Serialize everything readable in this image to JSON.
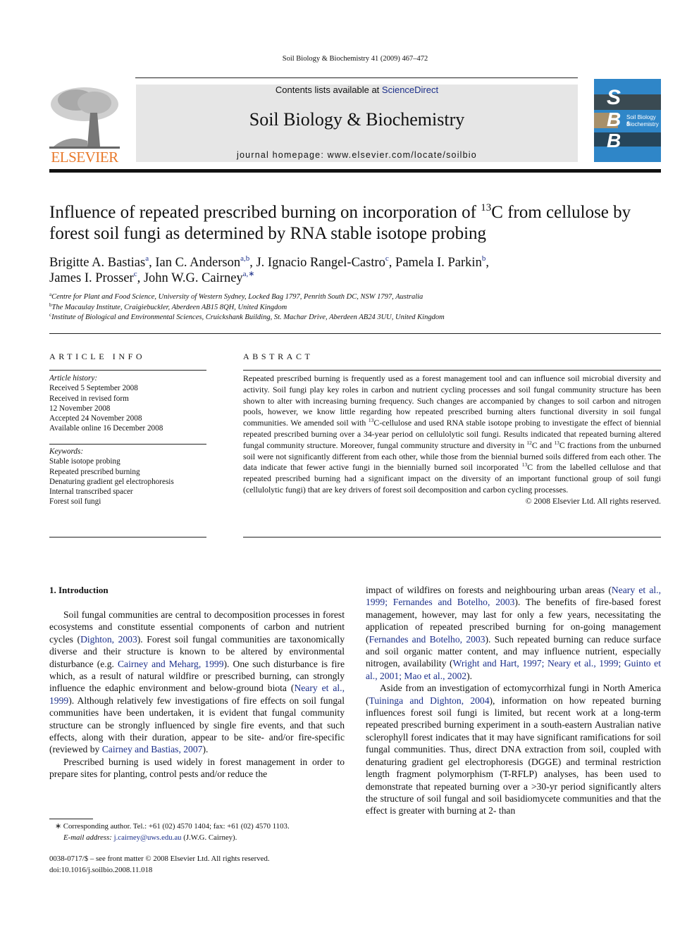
{
  "running_head": "Soil Biology & Biochemistry 41 (2009) 467–472",
  "publisher": {
    "name": "ELSEVIER",
    "brand_color": "#e8792b"
  },
  "masthead": {
    "contents_prefix": "Contents lists available at ",
    "contents_link": "ScienceDirect",
    "journal_title": "Soil Biology & Biochemistry",
    "homepage": "journal homepage: www.elsevier.com/locate/soilbio",
    "background_color": "#e6e6e6"
  },
  "cover": {
    "letters": [
      "S",
      "B",
      "B"
    ],
    "title_line1": "Soil Biology &",
    "title_line2": "Biochemistry",
    "color": "#2f86c8"
  },
  "article": {
    "title_part1": "Influence of repeated prescribed burning on incorporation of ",
    "title_sup": "13",
    "title_part2": "C from cellulose by forest soil fungi as determined by RNA stable isotope probing",
    "authors": [
      {
        "name": "Brigitte A. Bastias",
        "aff": "a",
        "sep": ", "
      },
      {
        "name": "Ian C. Anderson",
        "aff": "a,b",
        "sep": ", "
      },
      {
        "name": "J. Ignacio Rangel-Castro",
        "aff": "c",
        "sep": ", "
      },
      {
        "name": "Pamela I. Parkin",
        "aff": "b",
        "sep": ","
      },
      {
        "name": "James I. Prosser",
        "aff": "c",
        "sep": ", "
      },
      {
        "name": "John W.G. Cairney",
        "aff": "a,∗",
        "sep": ""
      }
    ],
    "affiliations": [
      {
        "key": "a",
        "text": "Centre for Plant and Food Science, University of Western Sydney, Locked Bag 1797, Penrith South DC, NSW 1797, Australia"
      },
      {
        "key": "b",
        "text": "The Macaulay Institute, Craigiebuckler, Aberdeen AB15 8QH, United Kingdom"
      },
      {
        "key": "c",
        "text": "Institute of Biological and Environmental Sciences, Cruickshank Building, St. Machar Drive, Aberdeen AB24 3UU, United Kingdom"
      }
    ]
  },
  "article_info": {
    "heading": "ARTICLE INFO",
    "history_label": "Article history:",
    "history": [
      "Received 5 September 2008",
      "Received in revised form",
      "12 November 2008",
      "Accepted 24 November 2008",
      "Available online 16 December 2008"
    ],
    "keywords_label": "Keywords:",
    "keywords": [
      "Stable isotope probing",
      "Repeated prescribed burning",
      "Denaturing gradient gel electrophoresis",
      "Internal transcribed spacer",
      "Forest soil fungi"
    ]
  },
  "abstract": {
    "heading": "ABSTRACT",
    "s1": "Repeated prescribed burning is frequently used as a forest management tool and can influence soil microbial diversity and activity. Soil fungi play key roles in carbon and nutrient cycling processes and soil fungal community structure has been shown to alter with increasing burning frequency. Such changes are accompanied by changes to soil carbon and nitrogen pools, however, we know little regarding how repeated prescribed burning alters functional diversity in soil fungal communities. We amended soil with ",
    "sup13": "13",
    "sup12": "12",
    "s2": "C-cellulose and used RNA stable isotope probing to investigate the effect of biennial repeated prescribed burning over a 34-year period on cellulolytic soil fungi. Results indicated that repeated burning altered fungal community structure. Moreover, fungal community structure and diversity in ",
    "s3": "C and ",
    "s4": "C fractions from the unburned soil were not significantly different from each other, while those from the biennial burned soils differed from each other. The data indicate that fewer active fungi in the biennially burned soil incorporated ",
    "s5": "C from the labelled cellulose and that repeated prescribed burning had a significant impact on the diversity of an important functional group of soil fungi (cellulolytic fungi) that are key drivers of forest soil decomposition and carbon cycling processes.",
    "copyright": "© 2008 Elsevier Ltd. All rights reserved."
  },
  "introduction": {
    "heading": "1.  Introduction",
    "left": {
      "p1_a": "Soil fungal communities are central to decomposition processes in forest ecosystems and constitute essential components of carbon and nutrient cycles (",
      "p1_ref1": "Dighton, 2003",
      "p1_b": "). Forest soil fungal communities are taxonomically diverse and their structure is known to be altered by environmental disturbance (e.g. ",
      "p1_ref2": "Cairney and Meharg, 1999",
      "p1_c": "). One such disturbance is fire which, as a result of natural wildfire or prescribed burning, can strongly influence the edaphic environment and below-ground biota (",
      "p1_ref3": "Neary et al., 1999",
      "p1_d": "). Although relatively few investigations of fire effects on soil fungal communities have been undertaken, it is evident that fungal community structure can be strongly influenced by single fire events, and that such effects, along with their duration, appear to be site- and/or fire-specific (reviewed by ",
      "p1_ref4": "Cairney and Bastias, 2007",
      "p1_e": ").",
      "p2": "Prescribed burning is used widely in forest management in order to prepare sites for planting, control pests and/or reduce the"
    },
    "right": {
      "p1_a": "impact of wildfires on forests and neighbouring urban areas (",
      "p1_ref1": "Neary et al., 1999; Fernandes and Botelho, 2003",
      "p1_b": "). The benefits of fire-based forest management, however, may last for only a few years, necessitating the application of repeated prescribed burning for on-going management (",
      "p1_ref2": "Fernandes and Botelho, 2003",
      "p1_c": "). Such repeated burning can reduce surface and soil organic matter content, and may influence nutrient, especially nitrogen, availability (",
      "p1_ref3": "Wright and Hart, 1997; Neary et al., 1999; Guinto et al., 2001; Mao et al., 2002",
      "p1_d": ").",
      "p2_a": "Aside from an investigation of ectomycorrhizal fungi in North America (",
      "p2_ref1": "Tuininga and Dighton, 2004",
      "p2_b": "), information on how repeated burning influences forest soil fungi is limited, but recent work at a long-term repeated prescribed burning experiment in a south-eastern Australian native sclerophyll forest indicates that it may have significant ramifications for soil fungal communities. Thus, direct DNA extraction from soil, coupled with denaturing gradient gel electrophoresis (DGGE) and terminal restriction length fragment polymorphism (T-RFLP) analyses, has been used to demonstrate that repeated burning over a >30-yr period significantly alters the structure of soil fungal and soil basidiomycete communities and that the effect is greater with burning at 2- than"
    }
  },
  "footnotes": {
    "corresponding": "∗  Corresponding author. Tel.: +61 (02) 4570 1404; fax: +61 (02) 4570 1103.",
    "email_label": "E-mail address:",
    "email": "j.cairney@uws.edu.au",
    "email_suffix": " (J.W.G. Cairney).",
    "front_matter": "0038-0717/$ – see front matter © 2008 Elsevier Ltd. All rights reserved.",
    "doi": "doi:10.1016/j.soilbio.2008.11.018"
  }
}
